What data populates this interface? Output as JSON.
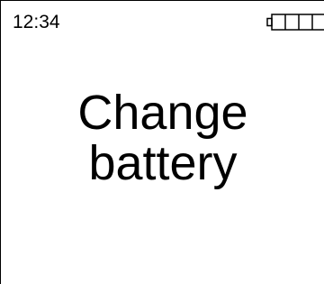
{
  "status_bar": {
    "time": "12:34",
    "battery": {
      "icon": "battery-empty-icon",
      "level_fraction": 0.0,
      "segments_total": 4,
      "segments_filled": 0
    }
  },
  "message": {
    "line1": "Change",
    "line2": "battery"
  },
  "colors": {
    "background": "#ffffff",
    "foreground": "#000000"
  }
}
